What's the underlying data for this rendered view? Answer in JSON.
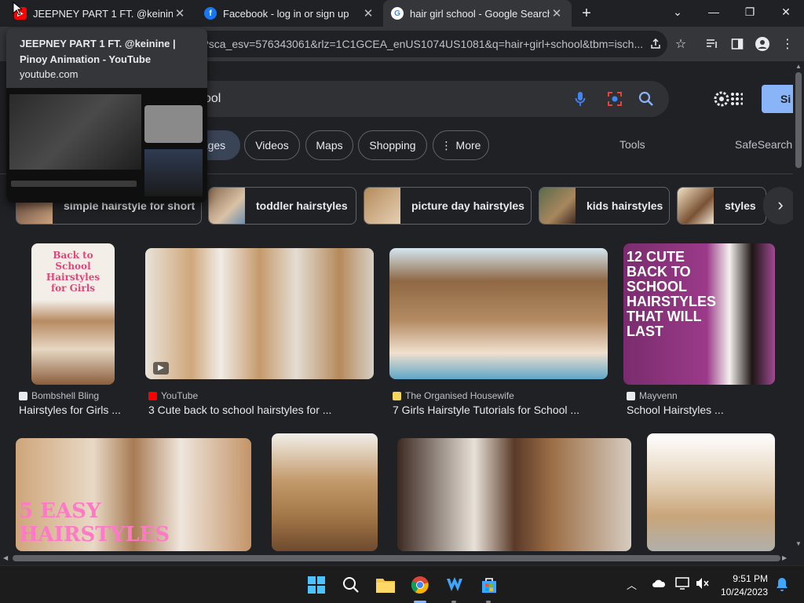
{
  "tabs": [
    {
      "title": "JEEPNEY PART 1 FT. @keinine | Pinoy Animation - YouTube",
      "active": false
    },
    {
      "title": "Facebook - log in or sign up",
      "active": false
    },
    {
      "title": "hair girl school - Google Search",
      "active": true
    }
  ],
  "new_tab_label": "+",
  "address": {
    "url": "?sca_esv=576343061&rlz=1C1GCEA_enUS1074US1081&q=hair+girl+school&tbm=isch..."
  },
  "tooltip": {
    "title": "JEEPNEY PART 1 FT. @keinine | Pinoy Animation - YouTube",
    "domain": "youtube.com"
  },
  "search": {
    "visible_query": "ool",
    "signin_label": "Si"
  },
  "nav": {
    "partial": "ages",
    "chips": [
      "Videos",
      "Maps",
      "Shopping",
      "More"
    ],
    "tools": "Tools",
    "safesearch": "SafeSearch"
  },
  "suggestions": [
    "simple hairstyle for short",
    "toddler hairstyles",
    "picture day hairstyles",
    "kids hairstyles",
    "styles"
  ],
  "results_row1": [
    {
      "source": "Bombshell Bling",
      "caption": "Hairstyles for Girls ...",
      "overlay": "Back to School Hairstyles for Girls",
      "fav_color": "#e8eaed"
    },
    {
      "source": "YouTube",
      "caption": "3 Cute back to school hairstyles for ...",
      "fav_color": "#ff0000"
    },
    {
      "source": "The Organised Housewife",
      "caption": "7 Girls Hairstyle Tutorials for School ...",
      "fav_color": "#f4d35e"
    },
    {
      "source": "Mayvenn",
      "caption": "School Hairstyles ...",
      "overlay": "12 CUTE BACK TO SCHOOL HAIRSTYLES THAT WILL LAST",
      "fav_color": "#e8eaed"
    }
  ],
  "results_row2": [
    {
      "overlay": "5 EASY HAIRSTYLES"
    },
    {},
    {},
    {}
  ],
  "taskbar": {
    "time": "9:51 PM",
    "date": "10/24/2023"
  },
  "colors": {
    "accent_blue": "#8ab4f8",
    "chrome_bg": "#35363a",
    "page_bg": "#202124"
  }
}
